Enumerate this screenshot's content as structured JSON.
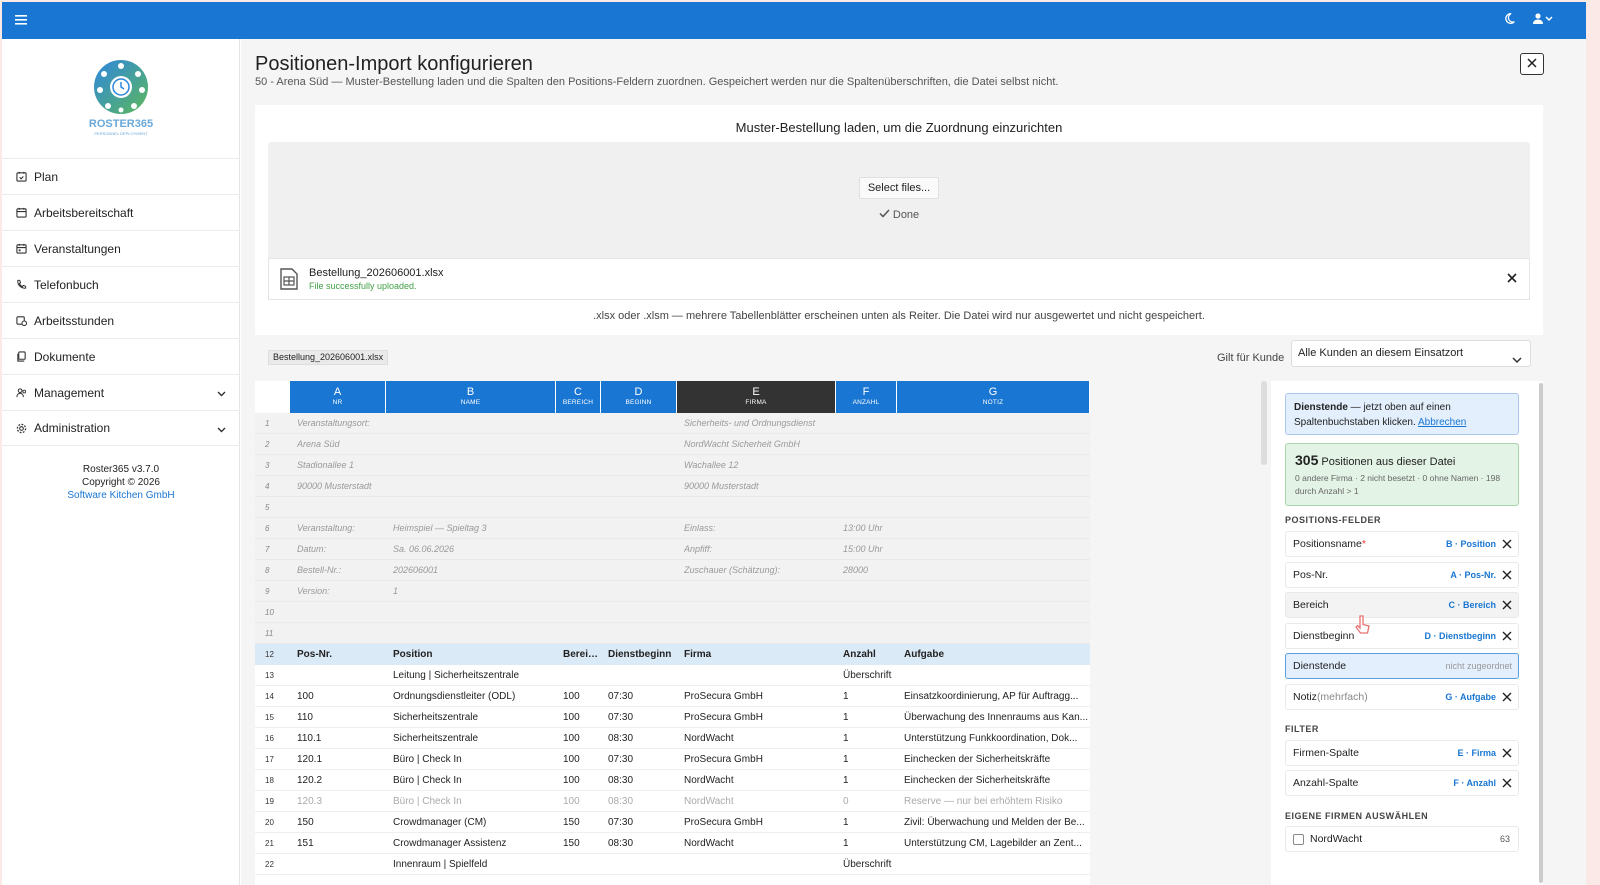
{
  "app": {
    "version": "Roster365 v3.7.0",
    "copyright": "Copyright © 2026",
    "company": "Software Kitchen GmbH",
    "logo_text": "ROSTER365",
    "logo_sub": "PERSONNEL DEPLOYMENT"
  },
  "topbar": {
    "menu_icon": "hamburger-icon",
    "theme_icon": "moon-icon",
    "user_icon": "user-icon"
  },
  "sidebar": {
    "items": [
      {
        "label": "Plan",
        "icon": "calendar-check-icon"
      },
      {
        "label": "Arbeitsbereitschaft",
        "icon": "calendar-edit-icon"
      },
      {
        "label": "Veranstaltungen",
        "icon": "calendar-icon"
      },
      {
        "label": "Telefonbuch",
        "icon": "phone-icon"
      },
      {
        "label": "Arbeitsstunden",
        "icon": "calendar-clock-icon"
      },
      {
        "label": "Dokumente",
        "icon": "documents-icon"
      },
      {
        "label": "Management",
        "icon": "users-icon",
        "expandable": true
      },
      {
        "label": "Administration",
        "icon": "gear-icon",
        "expandable": true
      }
    ]
  },
  "page": {
    "title": "Positionen-Import konfigurieren",
    "subtitle": "50 - Arena Süd — Muster-Bestellung laden und die Spalten den Positions-Feldern zuordnen. Gespeichert werden nur die Spaltenüberschriften, die Datei selbst nicht."
  },
  "upload": {
    "heading": "Muster-Bestellung laden, um die Zuordnung einzurichten",
    "select_label": "Select files...",
    "done_label": "Done",
    "file_name": "Bestellung_202606001.xlsx",
    "file_status": "File successfully uploaded.",
    "hint": ".xlsx oder .xlsm — mehrere Tabellenblätter erscheinen unten als Reiter. Die Datei wird nur ausgewertet und nicht gespeichert."
  },
  "sheet": {
    "tab": "Bestellung_202606001.xlsx",
    "gilt_label": "Gilt für Kunde",
    "gilt_value": "Alle Kunden an diesem Einsatzort",
    "columns": [
      {
        "letter": "A",
        "name": "NR"
      },
      {
        "letter": "B",
        "name": "NAME"
      },
      {
        "letter": "C",
        "name": "BEREICH"
      },
      {
        "letter": "D",
        "name": "BEGINN"
      },
      {
        "letter": "E",
        "name": "FIRMA"
      },
      {
        "letter": "F",
        "name": "ANZAHL"
      },
      {
        "letter": "G",
        "name": "NOTIZ"
      }
    ],
    "rows": [
      {
        "n": "1",
        "type": "meta",
        "c": [
          "Veranstaltungsort:",
          "",
          "",
          "",
          "Sicherheits- und Ordnungsdienst",
          "",
          ""
        ]
      },
      {
        "n": "2",
        "type": "meta",
        "c": [
          "Arena Süd",
          "",
          "",
          "",
          "NordWacht Sicherheit GmbH",
          "",
          ""
        ]
      },
      {
        "n": "3",
        "type": "meta",
        "c": [
          "Stadionallee 1",
          "",
          "",
          "",
          "Wachallee 12",
          "",
          ""
        ]
      },
      {
        "n": "4",
        "type": "meta",
        "c": [
          "90000 Musterstadt",
          "",
          "",
          "",
          "90000 Musterstadt",
          "",
          ""
        ]
      },
      {
        "n": "5",
        "type": "meta",
        "c": [
          "",
          "",
          "",
          "",
          "",
          "",
          ""
        ]
      },
      {
        "n": "6",
        "type": "meta",
        "c": [
          "Veranstaltung:",
          "Heimspiel — Spieltag 3",
          "",
          "",
          "Einlass:",
          "13:00 Uhr",
          ""
        ]
      },
      {
        "n": "7",
        "type": "meta",
        "c": [
          "Datum:",
          "Sa. 06.06.2026",
          "",
          "",
          "Anpfiff:",
          "15:00 Uhr",
          ""
        ]
      },
      {
        "n": "8",
        "type": "meta",
        "c": [
          "Bestell-Nr.:",
          "202606001",
          "",
          "",
          "Zuschauer (Schätzung):",
          "28000",
          ""
        ]
      },
      {
        "n": "9",
        "type": "meta",
        "c": [
          "Version:",
          "1",
          "",
          "",
          "",
          "",
          ""
        ]
      },
      {
        "n": "10",
        "type": "meta",
        "c": [
          "",
          "",
          "",
          "",
          "",
          "",
          ""
        ]
      },
      {
        "n": "11",
        "type": "meta",
        "c": [
          "",
          "",
          "",
          "",
          "",
          "",
          ""
        ]
      },
      {
        "n": "12",
        "type": "header",
        "c": [
          "Pos-Nr.",
          "Position",
          "Bereich",
          "Dienstbeginn",
          "Firma",
          "Anzahl",
          "Aufgabe"
        ]
      },
      {
        "n": "13",
        "type": "data",
        "c": [
          "",
          "Leitung | Sicherheitszentrale",
          "",
          "",
          "",
          "Überschrift",
          ""
        ]
      },
      {
        "n": "14",
        "type": "data",
        "c": [
          "100",
          "Ordnungsdienstleiter (ODL)",
          "100",
          "07:30",
          "ProSecura GmbH",
          "1",
          "Einsatzkoordinierung, AP für Auftragg..."
        ]
      },
      {
        "n": "15",
        "type": "data",
        "c": [
          "110",
          "Sicherheitszentrale",
          "100",
          "07:30",
          "ProSecura GmbH",
          "1",
          "Überwachung des Innenraums aus Kan..."
        ]
      },
      {
        "n": "16",
        "type": "data",
        "c": [
          "110.1",
          "Sicherheitszentrale",
          "100",
          "08:30",
          "NordWacht",
          "1",
          "Unterstützung Funkkoordination, Dok..."
        ]
      },
      {
        "n": "17",
        "type": "data",
        "c": [
          "120.1",
          "Büro | Check In",
          "100",
          "07:30",
          "ProSecura GmbH",
          "1",
          "Einchecken der Sicherheitskräfte"
        ]
      },
      {
        "n": "18",
        "type": "data",
        "c": [
          "120.2",
          "Büro | Check In",
          "100",
          "08:30",
          "NordWacht",
          "1",
          "Einchecken der Sicherheitskräfte"
        ]
      },
      {
        "n": "19",
        "type": "muted",
        "c": [
          "120.3",
          "Büro | Check In",
          "100",
          "08:30",
          "NordWacht",
          "0",
          "Reserve — nur bei erhöhtem Risiko"
        ]
      },
      {
        "n": "20",
        "type": "data",
        "c": [
          "150",
          "Crowdmanager (CM)",
          "150",
          "07:30",
          "ProSecura GmbH",
          "1",
          "Zivil: Überwachung und Melden der Be..."
        ]
      },
      {
        "n": "21",
        "type": "data",
        "c": [
          "151",
          "Crowdmanager Assistenz",
          "150",
          "08:30",
          "NordWacht",
          "1",
          "Unterstützung CM, Lagebilder an Zent..."
        ]
      },
      {
        "n": "22",
        "type": "data",
        "c": [
          "",
          "Innenraum | Spielfeld",
          "",
          "",
          "",
          "Überschrift",
          ""
        ]
      }
    ]
  },
  "panel": {
    "info_bold": "Dienstende",
    "info_text": " — jetzt oben auf einen Spaltenbuchstaben klicken.",
    "info_link": "Abbrechen",
    "stat_count": "305",
    "stat_text": " Positionen aus dieser Datei",
    "stat_sub": "0 andere Firma · 2 nicht besetzt · 0 ohne Namen · 198 durch Anzahl > 1",
    "section_fields": "POSITIONS-FELDER",
    "fields": [
      {
        "label": "Positionsname",
        "req": "*",
        "map": "B · Position"
      },
      {
        "label": "Pos-Nr.",
        "map": "A · Pos-Nr."
      },
      {
        "label": "Bereich",
        "map": "C · Bereich"
      },
      {
        "label": "Dienstbeginn",
        "map": "D · Dienstbeginn"
      },
      {
        "label": "Dienstende",
        "map": "nicht zugeordnet"
      },
      {
        "label": "Notiz",
        "opt": "(mehrfach)",
        "map": "G · Aufgabe"
      }
    ],
    "section_filter": "FILTER",
    "filters": [
      {
        "label": "Firmen-Spalte",
        "map": "E · Firma"
      },
      {
        "label": "Anzahl-Spalte",
        "map": "F · Anzahl"
      }
    ],
    "section_firms": "EIGENE FIRMEN AUSWÄHLEN",
    "firms": [
      {
        "label": "NordWacht",
        "count": "63"
      }
    ]
  }
}
